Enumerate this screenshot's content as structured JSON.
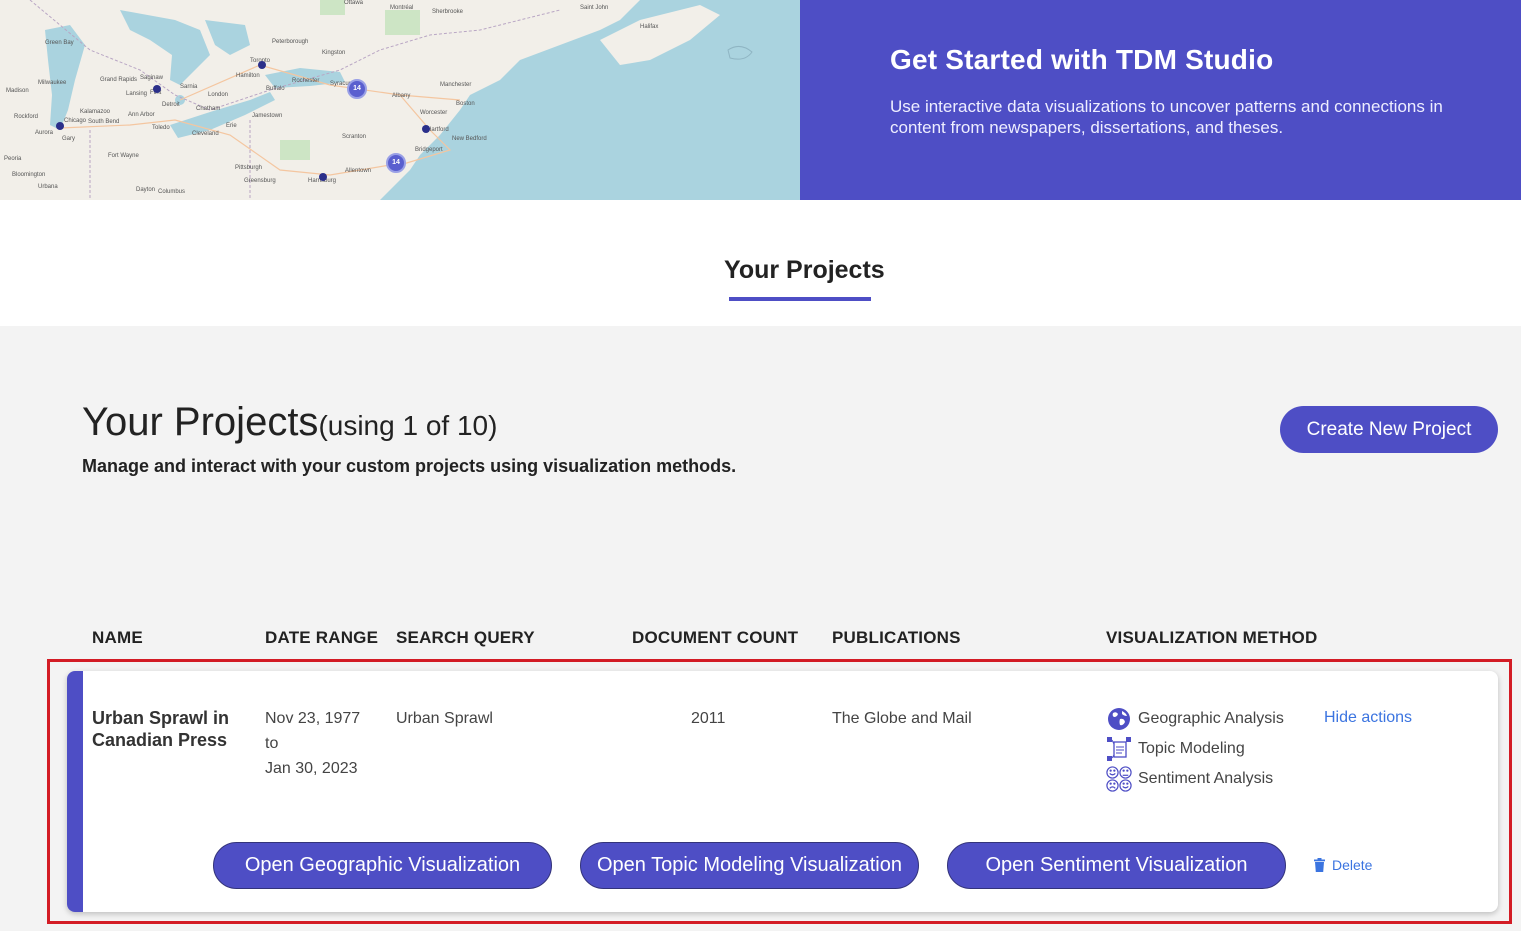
{
  "hero": {
    "title": "Get Started with TDM Studio",
    "description": "Use interactive data visualizations to uncover patterns and connections in content from newspapers, dissertations, and theses.",
    "map": {
      "clusters": [
        "14",
        "14"
      ],
      "labels": [
        "Ottawa",
        "Montréal",
        "Sherbrooke",
        "Saint John",
        "Halifax",
        "Peterborough",
        "Kingston",
        "Toronto",
        "Hamilton",
        "Buffalo",
        "Rochester",
        "Syracuse",
        "Albany",
        "Manchester",
        "Boston",
        "Worcester",
        "Hartford",
        "New Bedford",
        "Bridgeport",
        "Scranton",
        "Allentown",
        "Harrisburg",
        "Pittsburgh",
        "Jamestown",
        "Erie",
        "Cleveland",
        "Detroit",
        "Ann Arbor",
        "Lansing",
        "Grand Rapids",
        "Milwaukee",
        "Madison",
        "Chicago",
        "Rockford",
        "Aurora",
        "Gary",
        "South Bend",
        "Kalamazoo",
        "Fort Wayne",
        "Toledo",
        "Columbus",
        "Dayton",
        "Greensburg",
        "Urbana",
        "Bloomington",
        "Peoria",
        "London",
        "Chatham",
        "Sarnia",
        "Flint",
        "Green Bay",
        "Saginaw"
      ]
    }
  },
  "tabs": {
    "active": "Your Projects"
  },
  "projects": {
    "title": "Your Projects",
    "count_text": "(using 1 of 10)",
    "subtitle": "Manage and interact with your custom projects using visualization methods.",
    "create_button": "Create New Project",
    "columns": [
      "NAME",
      "DATE RANGE",
      "SEARCH QUERY",
      "DOCUMENT COUNT",
      "PUBLICATIONS",
      "VISUALIZATION METHOD"
    ],
    "rows": [
      {
        "name": "Urban Sprawl in Canadian Press",
        "date_from": "Nov 23, 1977",
        "date_to_word": "to",
        "date_to": "Jan 30, 2023",
        "query": "Urban Sprawl",
        "doc_count": "2011",
        "publications": "The Globe and Mail",
        "methods": [
          {
            "label": "Geographic Analysis",
            "icon": "globe-icon"
          },
          {
            "label": "Topic Modeling",
            "icon": "topic-network-icon"
          },
          {
            "label": "Sentiment Analysis",
            "icon": "faces-icon"
          }
        ],
        "hide_actions": "Hide actions",
        "actions": [
          "Open Geographic Visualization",
          "Open Topic Modeling Visualization",
          "Open Sentiment Visualization"
        ],
        "delete": "Delete"
      }
    ]
  },
  "colors": {
    "accent": "#4e4ec5",
    "link": "#3b74e0",
    "highlight": "#d31c25"
  }
}
